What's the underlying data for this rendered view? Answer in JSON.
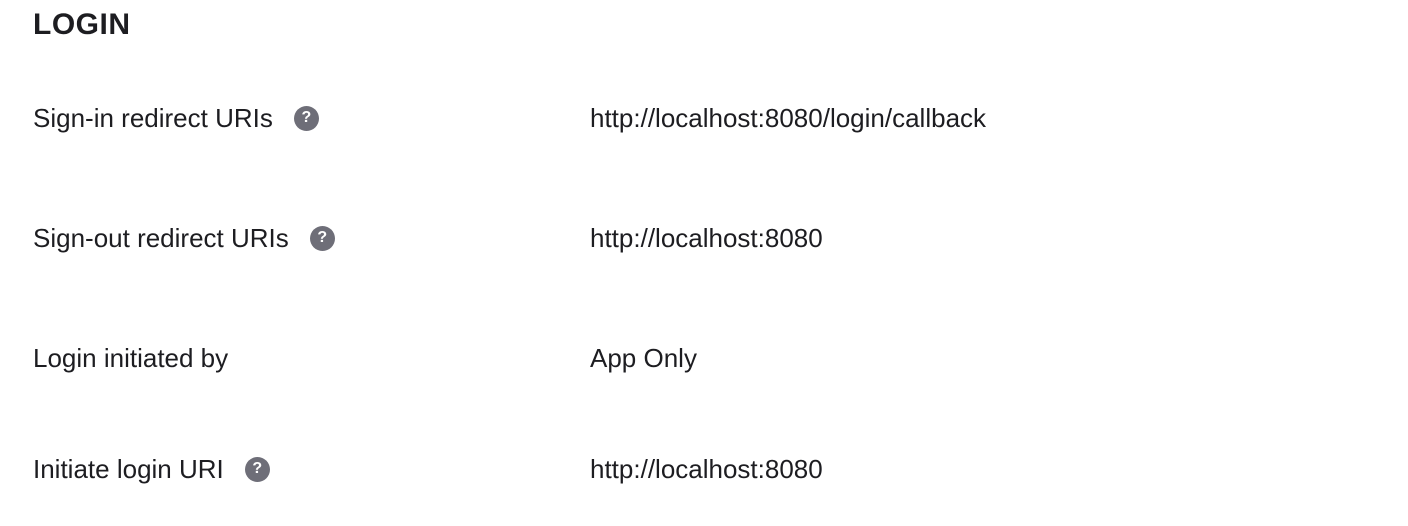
{
  "section": {
    "title": "LOGIN"
  },
  "rows": [
    {
      "label": "Sign-in redirect URIs",
      "has_help": true,
      "help_glyph": "?",
      "value": "http://localhost:8080/login/callback"
    },
    {
      "label": "Sign-out redirect URIs",
      "has_help": true,
      "help_glyph": "?",
      "value": "http://localhost:8080"
    },
    {
      "label": "Login initiated by",
      "has_help": false,
      "value": "App Only"
    },
    {
      "label": "Initiate login URI",
      "has_help": true,
      "help_glyph": "?",
      "value": "http://localhost:8080"
    }
  ],
  "colors": {
    "text": "#1d1d21",
    "help_icon_bg": "#6e6e78",
    "background": "#ffffff"
  },
  "icons": {
    "help": "help-question-icon"
  }
}
